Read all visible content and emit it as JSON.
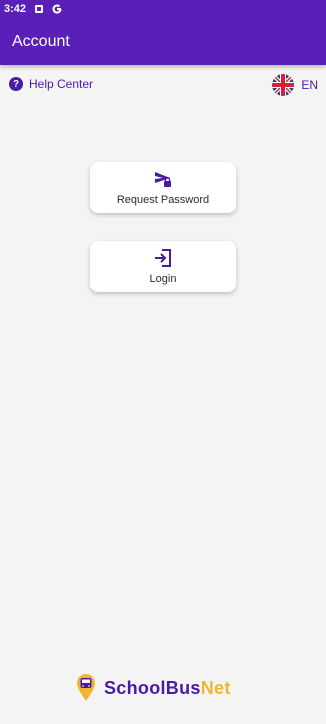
{
  "status_bar": {
    "time": "3:42",
    "icons": [
      "sim-icon",
      "google-icon"
    ]
  },
  "app_bar": {
    "title": "Account"
  },
  "top_actions": {
    "help": {
      "label": "Help Center",
      "icon": "help-icon"
    },
    "language": {
      "label": "EN",
      "icon": "uk-flag-icon"
    }
  },
  "cards": [
    {
      "label": "Request Password",
      "icon": "send-lock-icon"
    },
    {
      "label": "Login",
      "icon": "login-icon"
    }
  ],
  "brand": {
    "name_primary": "SchoolBus",
    "name_accent": "Net"
  },
  "colors": {
    "primary": "#5a1fb6",
    "text_primary": "#4b1aa3",
    "accent": "#f2b530",
    "background": "#f4f4f4"
  }
}
